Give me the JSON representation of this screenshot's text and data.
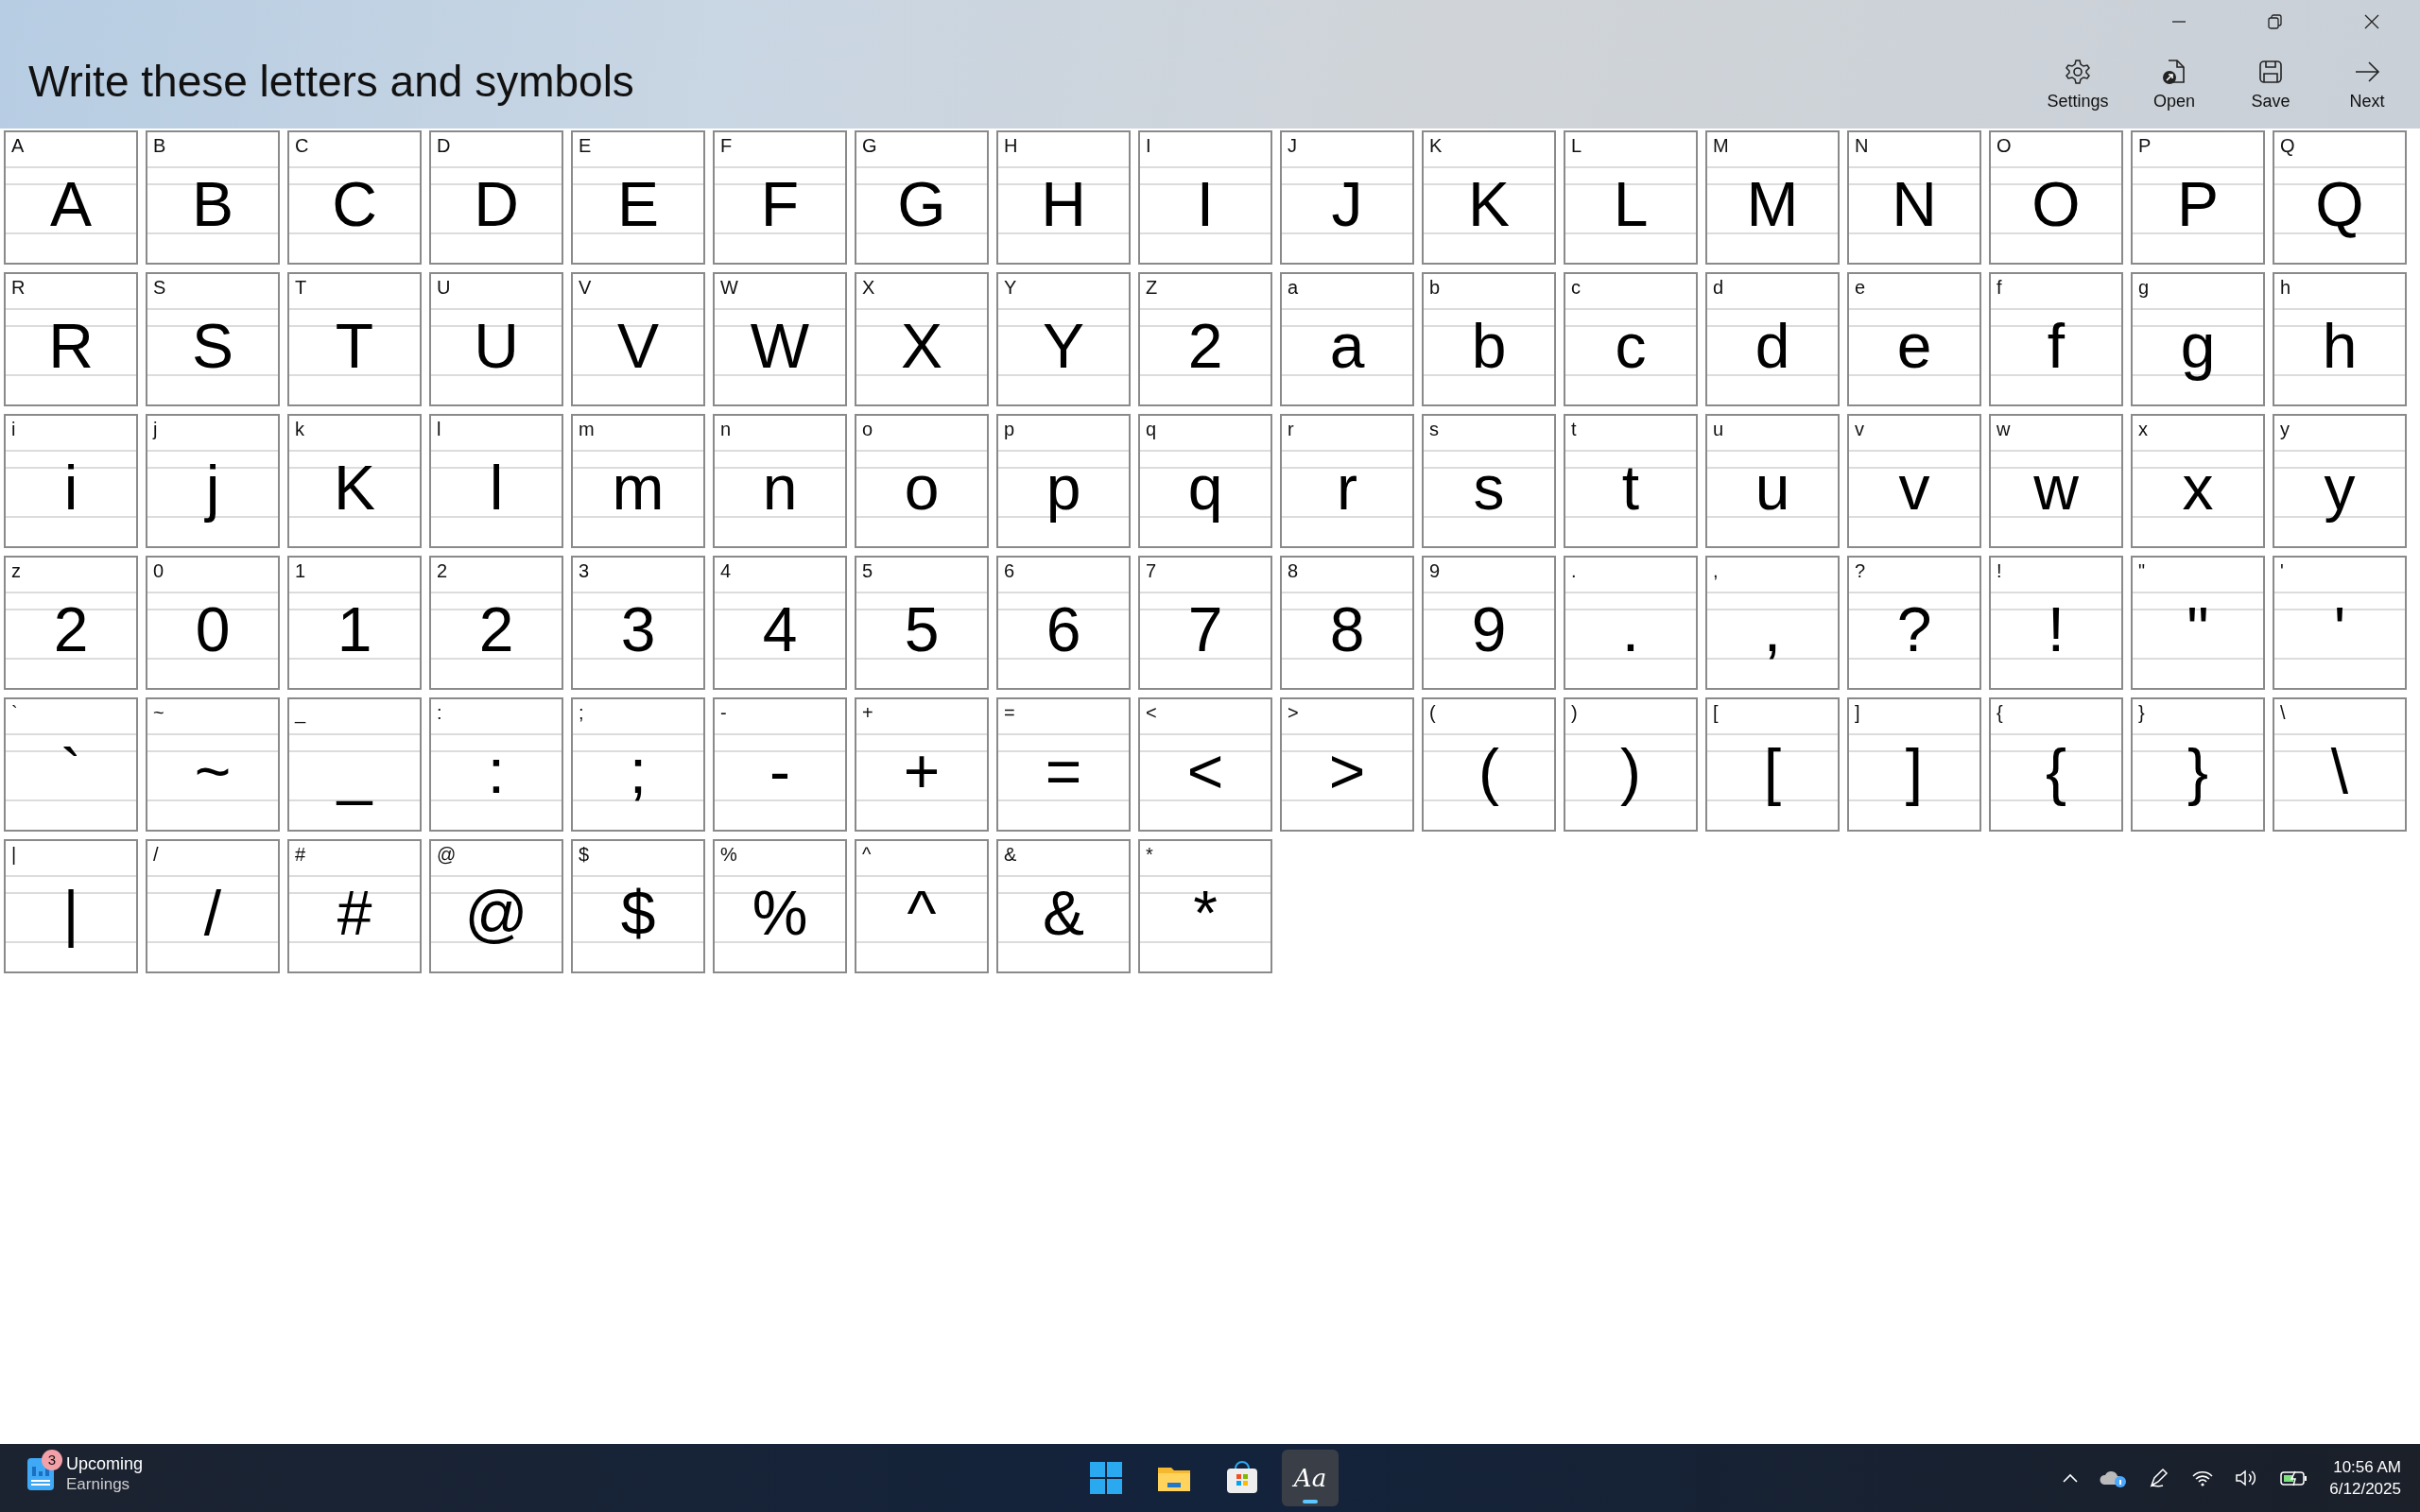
{
  "window": {
    "title": "Write these letters and symbols"
  },
  "toolbar": [
    {
      "kind": "settings",
      "label": "Settings"
    },
    {
      "kind": "open",
      "label": "Open"
    },
    {
      "kind": "save",
      "label": "Save"
    },
    {
      "kind": "next",
      "label": "Next"
    }
  ],
  "cells": [
    {
      "label": "A",
      "ink": "A"
    },
    {
      "label": "B",
      "ink": "B"
    },
    {
      "label": "C",
      "ink": "C"
    },
    {
      "label": "D",
      "ink": "D"
    },
    {
      "label": "E",
      "ink": "E"
    },
    {
      "label": "F",
      "ink": "F"
    },
    {
      "label": "G",
      "ink": "G"
    },
    {
      "label": "H",
      "ink": "H"
    },
    {
      "label": "I",
      "ink": "I"
    },
    {
      "label": "J",
      "ink": "J"
    },
    {
      "label": "K",
      "ink": "K"
    },
    {
      "label": "L",
      "ink": "L"
    },
    {
      "label": "M",
      "ink": "M"
    },
    {
      "label": "N",
      "ink": "N"
    },
    {
      "label": "O",
      "ink": "O"
    },
    {
      "label": "P",
      "ink": "P"
    },
    {
      "label": "Q",
      "ink": "Q"
    },
    {
      "label": "R",
      "ink": "R"
    },
    {
      "label": "S",
      "ink": "S"
    },
    {
      "label": "T",
      "ink": "T"
    },
    {
      "label": "U",
      "ink": "U"
    },
    {
      "label": "V",
      "ink": "V"
    },
    {
      "label": "W",
      "ink": "W"
    },
    {
      "label": "X",
      "ink": "X"
    },
    {
      "label": "Y",
      "ink": "Y"
    },
    {
      "label": "Z",
      "ink": "2"
    },
    {
      "label": "a",
      "ink": "a"
    },
    {
      "label": "b",
      "ink": "b"
    },
    {
      "label": "c",
      "ink": "c"
    },
    {
      "label": "d",
      "ink": "d"
    },
    {
      "label": "e",
      "ink": "e"
    },
    {
      "label": "f",
      "ink": "f"
    },
    {
      "label": "g",
      "ink": "g"
    },
    {
      "label": "h",
      "ink": "h"
    },
    {
      "label": "i",
      "ink": "i"
    },
    {
      "label": "j",
      "ink": "j"
    },
    {
      "label": "k",
      "ink": "K"
    },
    {
      "label": "l",
      "ink": "l"
    },
    {
      "label": "m",
      "ink": "m"
    },
    {
      "label": "n",
      "ink": "n"
    },
    {
      "label": "o",
      "ink": "o"
    },
    {
      "label": "p",
      "ink": "p"
    },
    {
      "label": "q",
      "ink": "q"
    },
    {
      "label": "r",
      "ink": "r"
    },
    {
      "label": "s",
      "ink": "s"
    },
    {
      "label": "t",
      "ink": "t"
    },
    {
      "label": "u",
      "ink": "u"
    },
    {
      "label": "v",
      "ink": "v"
    },
    {
      "label": "w",
      "ink": "w"
    },
    {
      "label": "x",
      "ink": "x"
    },
    {
      "label": "y",
      "ink": "y"
    },
    {
      "label": "z",
      "ink": "2"
    },
    {
      "label": "0",
      "ink": "0"
    },
    {
      "label": "1",
      "ink": "1"
    },
    {
      "label": "2",
      "ink": "2"
    },
    {
      "label": "3",
      "ink": "3"
    },
    {
      "label": "4",
      "ink": "4"
    },
    {
      "label": "5",
      "ink": "5"
    },
    {
      "label": "6",
      "ink": "6"
    },
    {
      "label": "7",
      "ink": "7"
    },
    {
      "label": "8",
      "ink": "8"
    },
    {
      "label": "9",
      "ink": "9"
    },
    {
      "label": ".",
      "ink": "."
    },
    {
      "label": ",",
      "ink": ","
    },
    {
      "label": "?",
      "ink": "?"
    },
    {
      "label": "!",
      "ink": "!"
    },
    {
      "label": "\"",
      "ink": "\""
    },
    {
      "label": "'",
      "ink": "'"
    },
    {
      "label": "`",
      "ink": "`"
    },
    {
      "label": "~",
      "ink": "~"
    },
    {
      "label": "_",
      "ink": "_"
    },
    {
      "label": ":",
      "ink": ":"
    },
    {
      "label": ";",
      "ink": ";"
    },
    {
      "label": "-",
      "ink": "-"
    },
    {
      "label": "+",
      "ink": "+"
    },
    {
      "label": "=",
      "ink": "="
    },
    {
      "label": "<",
      "ink": "<"
    },
    {
      "label": ">",
      "ink": ">"
    },
    {
      "label": "(",
      "ink": "("
    },
    {
      "label": ")",
      "ink": ")"
    },
    {
      "label": "[",
      "ink": "["
    },
    {
      "label": "]",
      "ink": "]"
    },
    {
      "label": "{",
      "ink": "{"
    },
    {
      "label": "}",
      "ink": "}"
    },
    {
      "label": "\\",
      "ink": "\\"
    },
    {
      "label": "|",
      "ink": "|"
    },
    {
      "label": "/",
      "ink": "/"
    },
    {
      "label": "#",
      "ink": "#"
    },
    {
      "label": "@",
      "ink": "@"
    },
    {
      "label": "$",
      "ink": "$"
    },
    {
      "label": "%",
      "ink": "%"
    },
    {
      "label": "^",
      "ink": "^"
    },
    {
      "label": "&",
      "ink": "&"
    },
    {
      "label": "*",
      "ink": "*"
    }
  ],
  "taskbar": {
    "widget": {
      "badge": "3",
      "title": "Upcoming",
      "subtitle": "Earnings"
    },
    "apps": [
      {
        "kind": "start",
        "selected": false
      },
      {
        "kind": "explorer",
        "selected": false
      },
      {
        "kind": "store",
        "selected": false
      },
      {
        "kind": "handwriting",
        "label": "Aa",
        "selected": true
      }
    ],
    "time": "10:56 AM",
    "date": "6/12/2025"
  }
}
